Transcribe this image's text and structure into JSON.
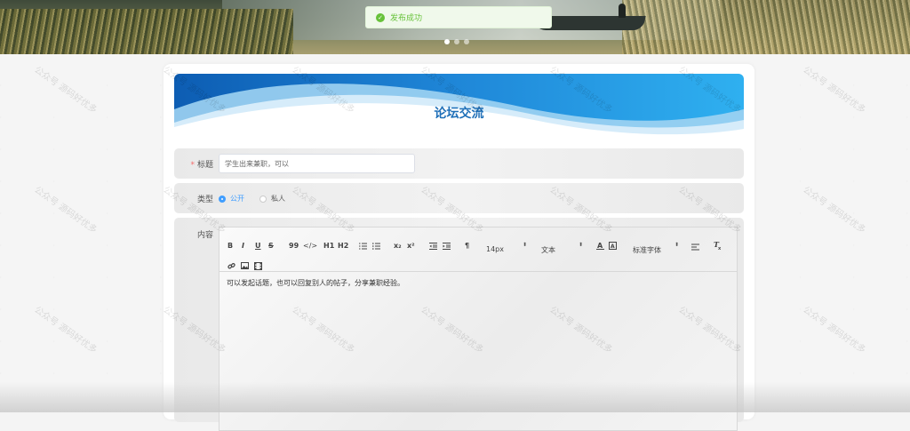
{
  "toast": {
    "message": "发布成功",
    "icon": "check-circle-icon",
    "color": "#67c23a"
  },
  "banner": {
    "slides": 3,
    "active_slide": 1
  },
  "watermark": "公众号 源码好优多",
  "page": {
    "title": "论坛交流"
  },
  "form": {
    "title_field": {
      "label": "标题",
      "required": true,
      "value": "学生出来兼职，可以"
    },
    "type_field": {
      "label": "类型",
      "options": [
        {
          "label": "公开",
          "selected": true
        },
        {
          "label": "私人",
          "selected": false
        }
      ]
    },
    "content_field": {
      "label": "内容",
      "toolbar": {
        "bold": "B",
        "italic": "I",
        "underline": "U",
        "strike": "S",
        "quote": "99",
        "code": "</>",
        "h1": "H1",
        "h2": "H2",
        "sub": "x₂",
        "sup": "x²",
        "direction": "¶",
        "size": "14px",
        "header": "文本",
        "font": "标准字体"
      },
      "text": "可以发起话题，也可以回复别人的帖子，分享兼职经验。"
    }
  },
  "colors": {
    "accent": "#409eff",
    "title": "#1e6fb8",
    "required": "#f56c6c"
  }
}
